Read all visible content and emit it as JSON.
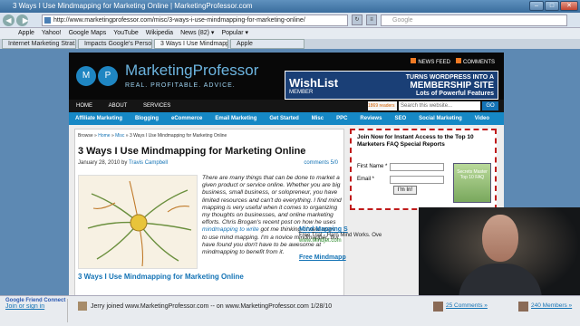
{
  "browser": {
    "title": "3 Ways I Use Mindmapping for Marketing Online | MarketingProfessor.com",
    "url": "http://www.marketingprofessor.com/misc/3-ways-i-use-mindmapping-for-marketing-online/",
    "search_placeholder": "Google",
    "bookmarks": [
      "Apple",
      "Yahoo!",
      "Google Maps",
      "YouTube",
      "Wikipedia",
      "News (82) ▾",
      "Popular ▾"
    ],
    "tabs": [
      "Internet Marketing Strat...",
      "Impacts Google's Perso...",
      "3 Ways I Use Mindmappi...",
      "Apple"
    ]
  },
  "site": {
    "brand": "MarketingProfessor",
    "tagline": "REAL. PROFITABLE. ADVICE.",
    "header_links": [
      "NEWS FEED",
      "COMMENTS"
    ],
    "banner": {
      "name": "WishList",
      "member": "MEMBER",
      "line1": "TURNS WORDPRESS INTO A",
      "line2": "MEMBERSHIP SITE",
      "line3": "Lots of Powerful Features"
    },
    "top_nav": [
      "HOME",
      "ABOUT",
      "SERVICES"
    ],
    "rss_count": "1869 readers",
    "search_placeholder": "Search this website...",
    "go": "GO",
    "cat_nav": [
      "Affiliate Marketing",
      "Blogging",
      "eCommerce",
      "Email Marketing",
      "Get Started",
      "Misc",
      "PPC",
      "Reviews",
      "SEO",
      "Social Marketing",
      "Video"
    ],
    "breadcrumb": {
      "prefix": "Browse » ",
      "home": "Home",
      "misc": "Misc",
      "current": " » 3 Ways I Use Mindmapping for Marketing Online"
    },
    "post": {
      "title": "3 Ways I Use Mindmapping for Marketing Online",
      "date": "January 28, 2010 by ",
      "author": "Travis Campbell",
      "comments": "comments 5/0",
      "p1": "There are many things that can be done to market a given product or service online. Whether you are big business, small business, or solopreneur, you have limited resources and can't do everything.  I find mind mapping is very useful when it comes to organizing my thoughts on businesses, and online marketing efforts.  Chris Brogan's recent post on how he uses ",
      "link": "mindmapping to write",
      "p2": " got me thinking of new ways to use mind mapping.  I'm a novice mindmapper, but have found you don't have to be awesome at mindmapping to benefit from it.",
      "subheading": "3 Ways I Use Mindmapping for Marketing Online"
    },
    "optin": {
      "heading": "Join Now for Instant Access to the Top 10 Marketers FAQ Special Reports",
      "first_name": "First Name *",
      "email": "Email *",
      "button": "I'm In!",
      "book": "Secrets Master Top 10 FAQ"
    },
    "ads": [
      {
        "title": "Mind Mapping S",
        "desc": "Free Trial - Harn Mind Works. Ove",
        "url": "www.Mindjet.com"
      },
      {
        "title": "Free Mindmapp",
        "desc": "",
        "url": ""
      }
    ]
  },
  "friend_connect": {
    "brand": "Google Friend Connect",
    "join": "Join or sign in",
    "activity": "Jerry joined www.MarketingProfessor.com -- on www.MarketingProfessor.com  1/28/10",
    "comments": "25 Comments »",
    "members": "240 Members »"
  }
}
